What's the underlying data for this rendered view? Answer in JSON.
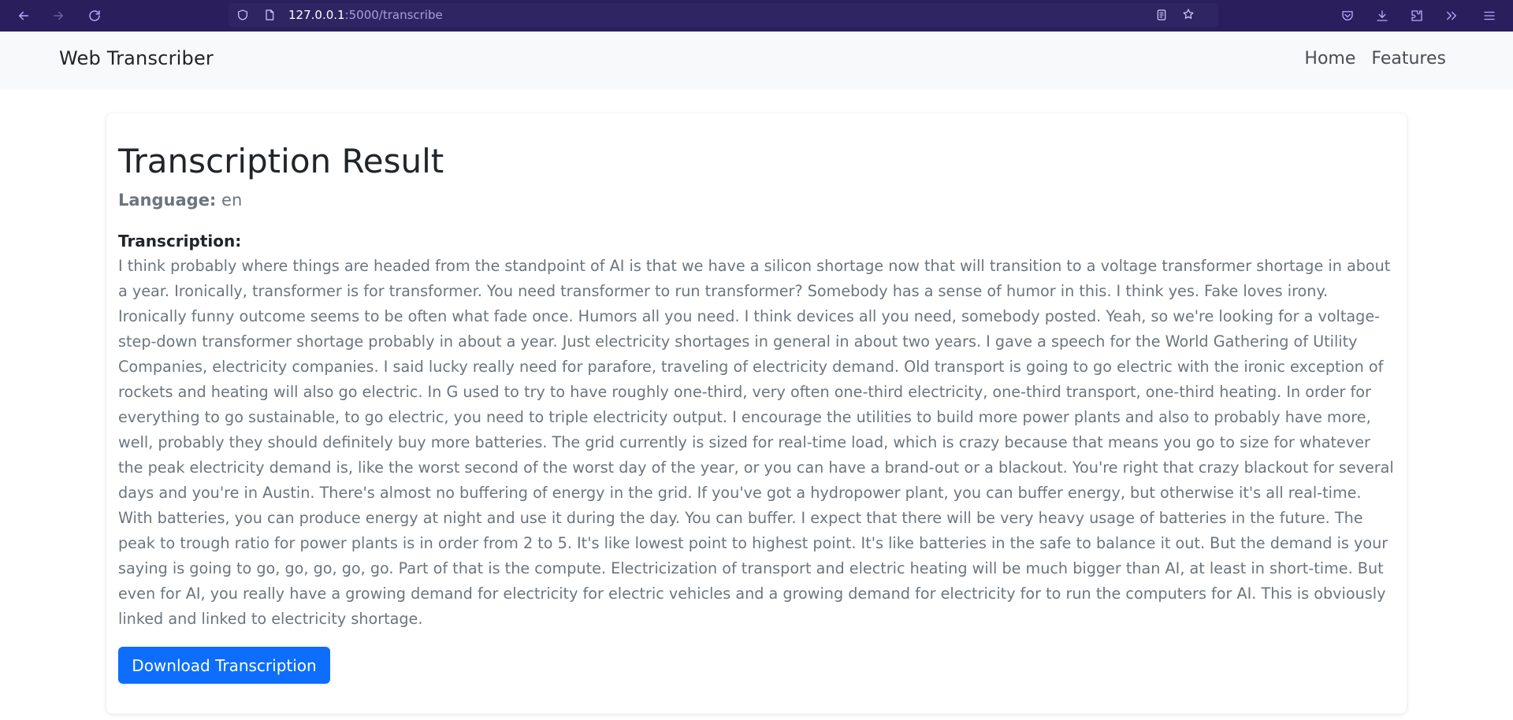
{
  "browser": {
    "url_host": "127.0.0.1",
    "url_path": ":5000/transcribe",
    "icons": [
      "back-arrow-icon",
      "forward-arrow-icon",
      "reload-icon",
      "shield-icon",
      "page-icon",
      "reader-view-icon",
      "bookmark-star-icon",
      "pocket-icon",
      "download-icon",
      "extensions-icon",
      "overflow-chevrons-icon",
      "menu-icon"
    ]
  },
  "navbar": {
    "brand": "Web Transcriber",
    "links": [
      "Home",
      "Features"
    ]
  },
  "result": {
    "title": "Transcription Result",
    "language_label": "Language:",
    "language_value": "en",
    "transcription_label": "Transcription:",
    "transcription_text": "I think probably where things are headed from the standpoint of AI is that we have a silicon shortage now that will transition to a voltage transformer shortage in about a year. Ironically, transformer is for transformer. You need transformer to run transformer? Somebody has a sense of humor in this. I think yes. Fake loves irony. Ironically funny outcome seems to be often what fade once. Humors all you need. I think devices all you need, somebody posted. Yeah, so we're looking for a voltage-step-down transformer shortage probably in about a year. Just electricity shortages in general in about two years. I gave a speech for the World Gathering of Utility Companies, electricity companies. I said lucky really need for parafore, traveling of electricity demand. Old transport is going to go electric with the ironic exception of rockets and heating will also go electric. In G used to try to have roughly one-third, very often one-third electricity, one-third transport, one-third heating. In order for everything to go sustainable, to go electric, you need to triple electricity output. I encourage the utilities to build more power plants and also to probably have more, well, probably they should definitely buy more batteries. The grid currently is sized for real-time load, which is crazy because that means you go to size for whatever the peak electricity demand is, like the worst second of the worst day of the year, or you can have a brand-out or a blackout. You're right that crazy blackout for several days and you're in Austin. There's almost no buffering of energy in the grid. If you've got a hydropower plant, you can buffer energy, but otherwise it's all real-time. With batteries, you can produce energy at night and use it during the day. You can buffer. I expect that there will be very heavy usage of batteries in the future. The peak to trough ratio for power plants is in order from 2 to 5. It's like lowest point to highest point. It's like batteries in the safe to balance it out. But the demand is your saying is going to go, go, go, go, go. Part of that is the compute. Electricization of transport and electric heating will be much bigger than AI, at least in short-time. But even for AI, you really have a growing demand for electricity for electric vehicles and a growing demand for electricity for to run the computers for AI. This is obviously linked and linked to electricity shortage.",
    "download_label": "Download Transcription"
  },
  "colors": {
    "browser_chrome": "#2b1e5c",
    "navbar_bg": "#f8f9fa",
    "primary_button": "#0d6efd",
    "muted_text": "#6c757d"
  }
}
